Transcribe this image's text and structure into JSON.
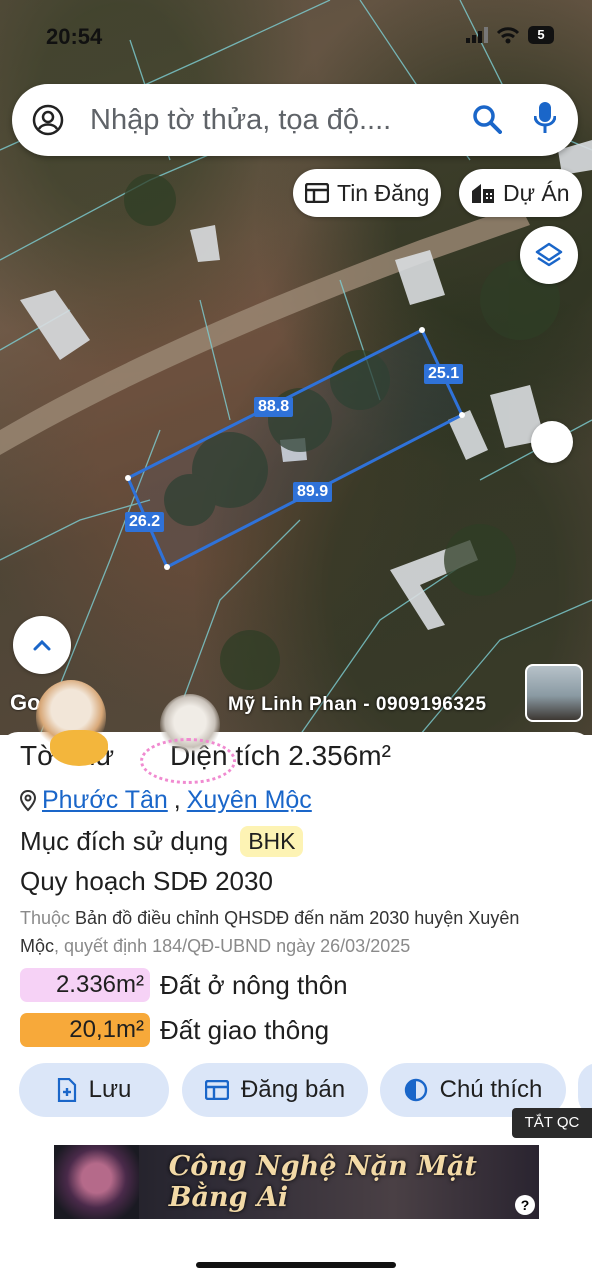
{
  "status_bar": {
    "time": "20:54",
    "battery": "5"
  },
  "search": {
    "placeholder": "Nhập tờ thửa, tọa độ...."
  },
  "chips": {
    "tin_dang": "Tin Đăng",
    "du_an": "Dự Án"
  },
  "map": {
    "google_label": "Go",
    "owner_label": "Mỹ Linh Phan - 0909196325",
    "dimensions": [
      "88.8",
      "25.1",
      "89.9",
      "26.2"
    ]
  },
  "parcel": {
    "title_prefix": "Tờ",
    "title_mid": "Thử",
    "area_label": "Diện tích",
    "area_value": "2.356m²",
    "commune": "Phước Tân",
    "separator": ",",
    "district": "Xuyên Mộc",
    "purpose_label": "Mục đích sử dụng",
    "purpose_code": "BHK",
    "plan_title": "Quy hoạch SDĐ 2030",
    "source_prefix": "Thuộc",
    "source_map": "Bản đồ điều chỉnh QHSDĐ đến năm 2030 huyện Xuyên Mộc",
    "source_decision": ", quyết định 184/QĐ-UBND ngày 26/03/2025",
    "zones": [
      {
        "value": "2.336m²",
        "label": "Đất ở nông thôn",
        "color": "#f6d2f6"
      },
      {
        "value": "20,1m²",
        "label": "Đất giao thông",
        "color": "#f7a93a"
      }
    ]
  },
  "actions": {
    "save": "Lưu",
    "sell": "Đăng bán",
    "legend": "Chú thích"
  },
  "ad": {
    "close_label": "TẮT QC",
    "headline": "Công Nghệ Nặn Mặt Bằng Ai",
    "help": "?"
  },
  "colors": {
    "accent": "#1a66c9",
    "button_bg": "#dbe6f8",
    "parcel_outline": "#2f72d9"
  }
}
